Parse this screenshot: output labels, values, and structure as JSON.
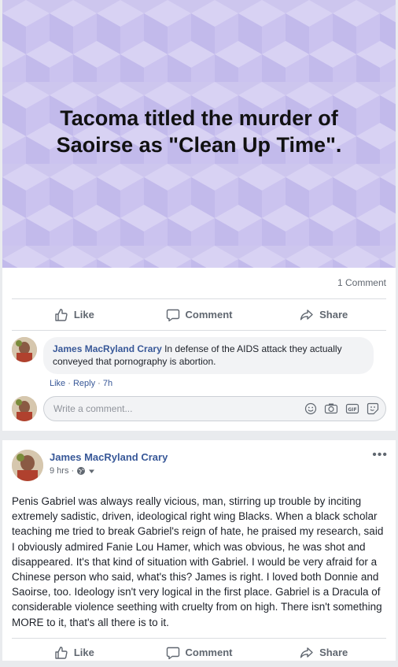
{
  "post1": {
    "image_caption_line1": "Tacoma titled the murder of",
    "image_caption_line2": "Saoirse as \"Clean Up Time\".",
    "image_bg_color": "#cdc6ee",
    "comment_count": "1 Comment",
    "actions": {
      "like": "Like",
      "comment": "Comment",
      "share": "Share"
    },
    "comments": [
      {
        "author": "James MacRyland Crary",
        "text": "In defense of the AIDS attack they actually conveyed that pornography is abortion.",
        "like": "Like",
        "reply": "Reply",
        "time": "7h"
      }
    ],
    "write_placeholder": "Write a comment...",
    "write_icons": [
      "emoji-icon",
      "camera-icon",
      "gif-icon",
      "sticker-icon"
    ]
  },
  "post2": {
    "author": "James MacRyland Crary",
    "time": "9 hrs ·",
    "body": "Penis Gabriel was always really vicious, man, stirring up trouble by inciting extremely sadistic, driven, ideological right wing Blacks. When a black scholar teaching me tried to break Gabriel's reign of hate, he praised my research, said I obviously admired Fanie Lou Hamer, which was obvious, he was shot and disappeared. It's that kind of situation with Gabriel. I would be very afraid for a Chinese person who said, what's this? James is right. I loved both Donnie and Saoirse, too. Ideology isn't very logical in the first place. Gabriel is a Dracula of considerable violence seething with cruelty from on high. There isn't something MORE to it, that's all there is to it.",
    "more": "•••",
    "actions": {
      "like": "Like",
      "comment": "Comment",
      "share": "Share"
    }
  },
  "colors": {
    "link": "#385898",
    "muted": "#606770",
    "page_bg": "#e9ebee"
  }
}
